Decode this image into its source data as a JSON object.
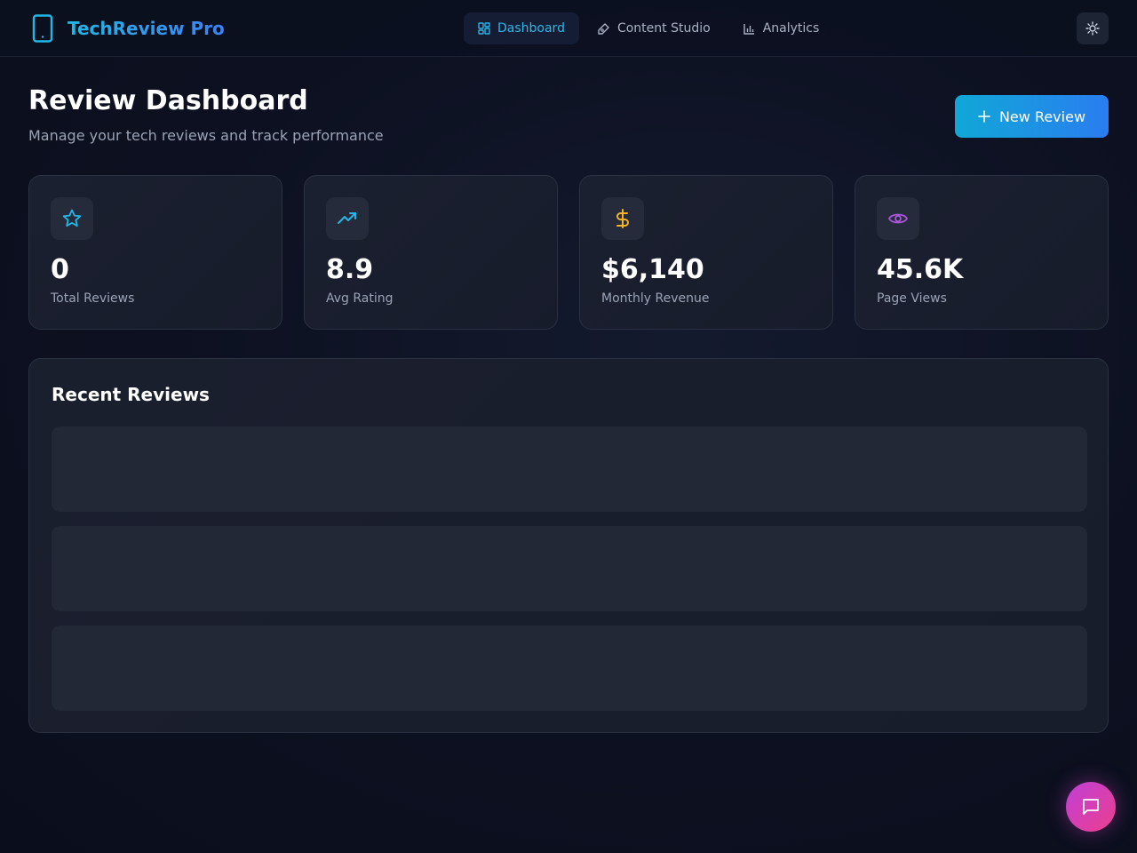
{
  "brand": {
    "name": "TechReview Pro"
  },
  "nav": {
    "items": [
      {
        "label": "Dashboard",
        "icon": "dashboard-icon",
        "active": true
      },
      {
        "label": "Content Studio",
        "icon": "pen-icon",
        "active": false
      },
      {
        "label": "Analytics",
        "icon": "bar-chart-icon",
        "active": false
      }
    ]
  },
  "header": {
    "title": "Review Dashboard",
    "subtitle": "Manage your tech reviews and track performance",
    "new_button_label": "New Review"
  },
  "stats": [
    {
      "value": "0",
      "label": "Total Reviews",
      "icon": "star-icon",
      "color": "#22b7e6"
    },
    {
      "value": "8.9",
      "label": "Avg Rating",
      "icon": "trending-up-icon",
      "color": "#22b7e6"
    },
    {
      "value": "$6,140",
      "label": "Monthly Revenue",
      "icon": "dollar-icon",
      "color": "#f5b423"
    },
    {
      "value": "45.6K",
      "label": "Page Views",
      "icon": "eye-icon",
      "color": "#a855d8"
    }
  ],
  "recent": {
    "title": "Recent Reviews"
  },
  "colors": {
    "accent": "#22b7e6",
    "background": "#0c1020",
    "card": "#1b2030",
    "fab_start": "#c03fd8",
    "fab_end": "#ec3f8c"
  }
}
